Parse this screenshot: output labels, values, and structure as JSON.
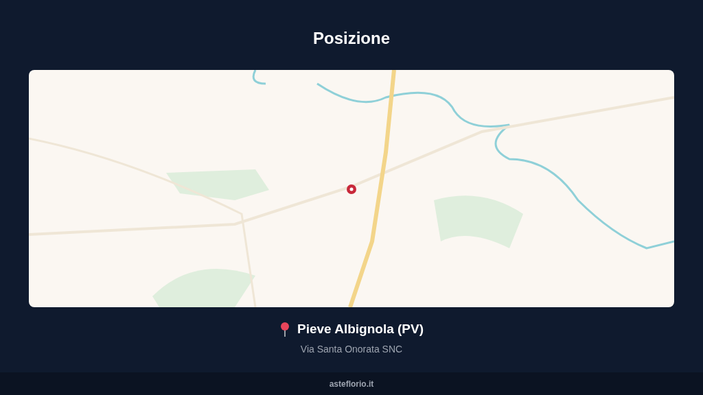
{
  "title": "Posizione",
  "location": {
    "name": "Pieve Albignola (PV)",
    "address": "Via Santa Onorata SNC"
  },
  "footer": {
    "site": "asteflorio.it"
  }
}
